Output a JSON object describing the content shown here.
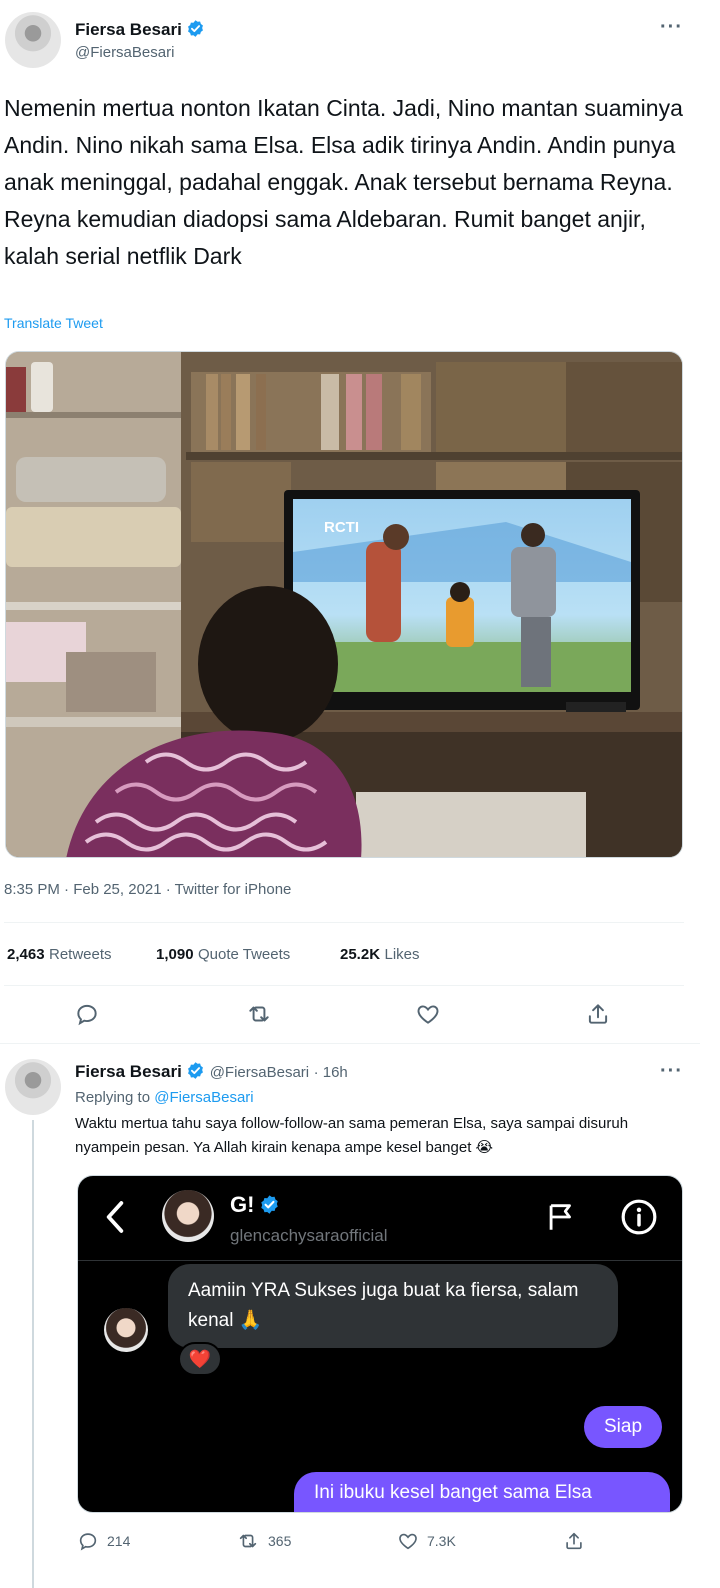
{
  "tweet": {
    "author_name": "Fiersa Besari",
    "author_handle": "@FiersaBesari",
    "more_label": "···",
    "text": "Nemenin mertua nonton Ikatan Cinta. Jadi, Nino mantan suaminya Andin. Nino nikah sama Elsa. Elsa adik tirinya Andin. Andin punya anak meninggal, padahal enggak. Anak tersebut bernama Reyna. Reyna kemudian diadopsi sama Aldebaran. Rumit banget anjir, kalah serial netflik Dark",
    "translate_label": "Translate Tweet",
    "tv_logo": "RCTI",
    "timestamp": "8:35 PM · Feb 25, 2021 · Twitter for iPhone",
    "stats": {
      "retweets_count": "2,463",
      "retweets_label": "Retweets",
      "quotes_count": "1,090",
      "quotes_label": "Quote Tweets",
      "likes_count": "25.2K",
      "likes_label": "Likes"
    },
    "actions": [
      "reply-icon",
      "retweet-icon",
      "like-icon",
      "share-icon"
    ]
  },
  "reply": {
    "author_name": "Fiersa Besari",
    "author_handle": "@FiersaBesari",
    "time": "· 16h",
    "more_label": "···",
    "replying_prefix": "Replying to",
    "replying_handle": "@FiersaBesari",
    "text": "Waktu mertua tahu saya follow-follow-an sama pemeran Elsa, saya sampai disuruh nyampein pesan. Ya Allah kirain kenapa ampe kesel banget 😭",
    "dm": {
      "contact_name": "G!",
      "contact_handle": "glencachysaraofficial",
      "incoming_message": "Aamiin YRA Sukses juga buat ka fiersa, salam kenal 🙏",
      "reaction": "❤️",
      "outgoing_1": "Siap",
      "outgoing_2": "Ini ibuku kesel banget sama Elsa"
    },
    "action_counts": {
      "replies": "214",
      "retweets": "365",
      "likes": "7.3K"
    }
  },
  "colors": {
    "accent": "#1d9bf0",
    "dm_purple": "#7856ff",
    "secondary_text": "#536471"
  }
}
